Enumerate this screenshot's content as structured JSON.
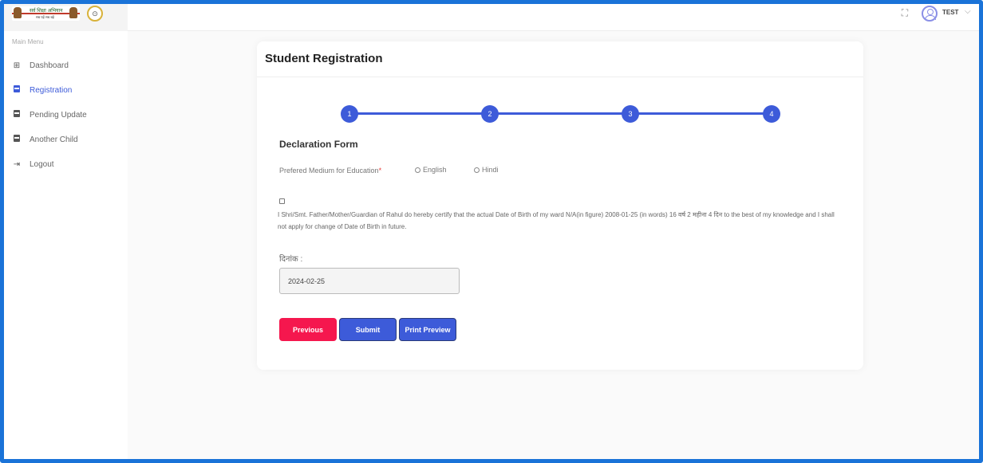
{
  "header": {
    "logo_text": "सर्व शिक्षा अभियान",
    "logo_subtext": "सब पढ़ें सब बढ़ें",
    "user_name": "TEST",
    "chevron": "⌵",
    "icons": [
      "fullscreen-icon",
      "user-avatar-icon",
      "chevron-down-icon"
    ]
  },
  "sidebar": {
    "menu_title": "Main Menu",
    "items": [
      {
        "label": "Dashboard",
        "icon": "grid-icon"
      },
      {
        "label": "Registration",
        "icon": "book-icon",
        "active": true
      },
      {
        "label": "Pending Update",
        "icon": "book-icon"
      },
      {
        "label": "Another Child",
        "icon": "book-icon"
      },
      {
        "label": "Logout",
        "icon": "logout-icon"
      }
    ]
  },
  "main": {
    "title": "Student Registration",
    "steps": [
      "1",
      "2",
      "3",
      "4"
    ],
    "section_title": "Declaration Form",
    "medium_label": "Prefered Medium for Education",
    "required_mark": "*",
    "medium_options": [
      "English",
      "Hindi"
    ],
    "declaration_text": "I Shri/Smt. Father/Mother/Guardian of Rahul do hereby certify that the actual Date of Birth of my ward N/A(in figure) 2008-01-25 (in words) 16 वर्ष 2 महीना 4 दिन to the best of my knowledge and I shall not apply for change of Date of Birth in future.",
    "date_label": "दिनांक :",
    "date_value": "2024-02-25",
    "buttons": {
      "previous": "Previous",
      "submit": "Submit",
      "print_preview": "Print Preview"
    }
  },
  "colors": {
    "accent": "#3d5bd9",
    "danger": "#f5174e",
    "frame": "#1a73d8"
  }
}
